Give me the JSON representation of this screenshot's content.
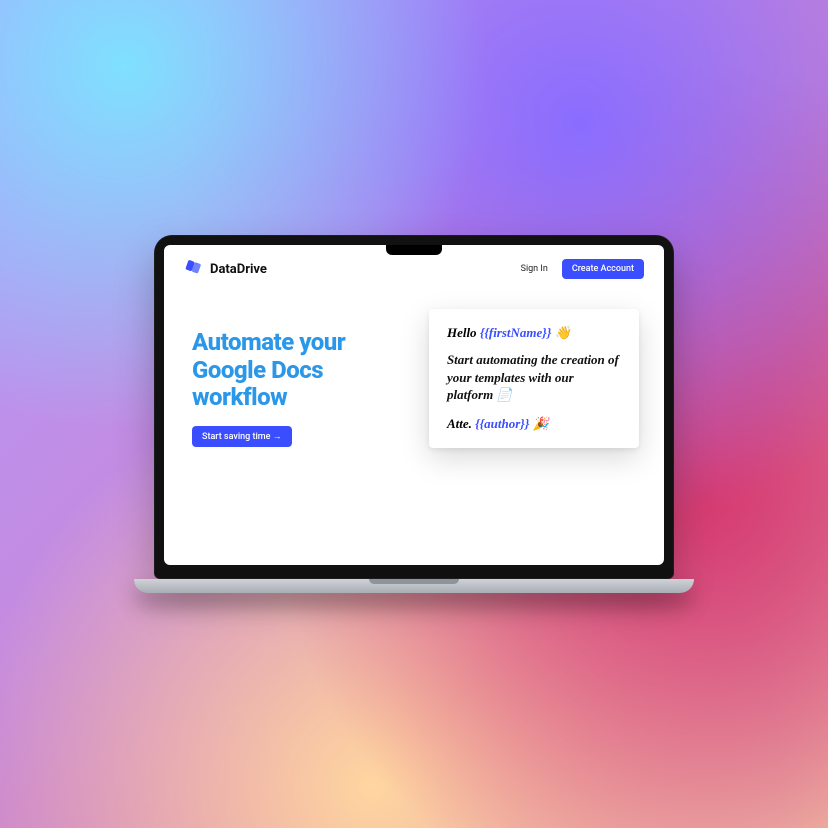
{
  "brand": {
    "name": "DataDrive"
  },
  "nav": {
    "signin_label": "Sign In",
    "create_label": "Create Account"
  },
  "hero": {
    "headline": "Automate your Google Docs workflow",
    "cta_label": "Start saving time →"
  },
  "card": {
    "greeting_prefix": "Hello ",
    "greeting_var": "{{firstName}}",
    "greeting_emoji": " 👋",
    "body": "Start automating the creation of your templates with our platform 📄",
    "signoff_prefix": "Atte. ",
    "signoff_var": "{{author}}",
    "signoff_emoji": " 🎉"
  },
  "colors": {
    "accent": "#3a4dff",
    "headline": "#2a97e8"
  }
}
